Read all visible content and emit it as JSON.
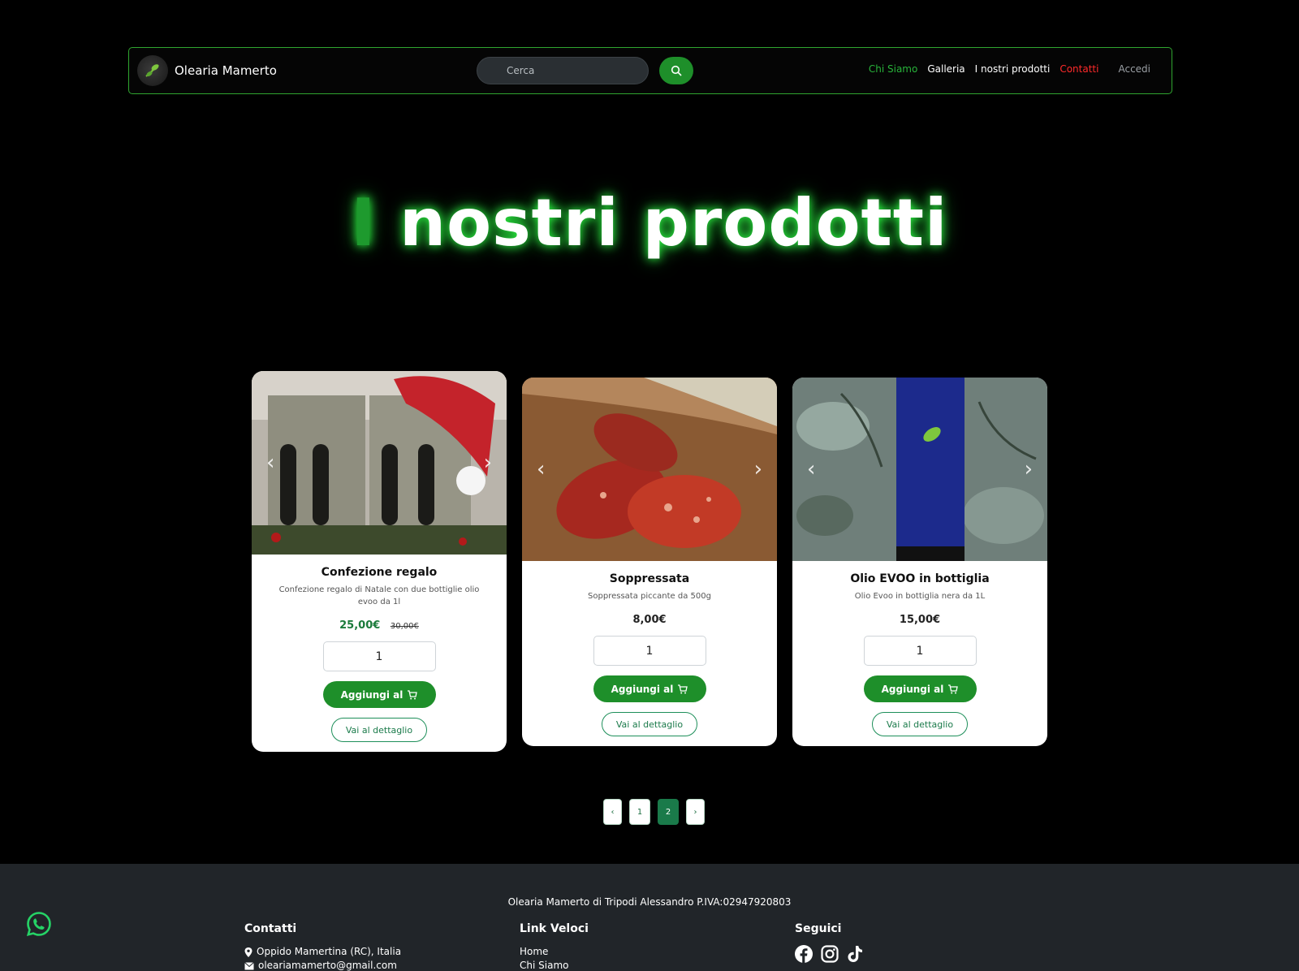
{
  "navbar": {
    "brand": "Olearia Mamerto",
    "search_placeholder": "Cerca",
    "links": {
      "chi_siamo": "Chi Siamo",
      "galleria": "Galleria",
      "prodotti": "I nostri prodotti",
      "contatti": "Contatti",
      "accedi": "Accedi"
    }
  },
  "hero": {
    "accent": "I",
    "rest": " nostri prodotti"
  },
  "products": [
    {
      "title": "Confezione regalo",
      "description": "Confezione regalo di Natale con due bottiglie olio evoo da 1l",
      "price": "25,00€",
      "old_price": "30,00€",
      "quantity": "1",
      "add_label": "Aggiungi al",
      "detail_label": "Vai al dettaglio"
    },
    {
      "title": "Soppressata",
      "description": "Soppressata piccante da 500g",
      "price": "8,00€",
      "quantity": "1",
      "add_label": "Aggiungi al",
      "detail_label": "Vai al dettaglio"
    },
    {
      "title": "Olio EVOO in bottiglia",
      "description": "Olio Evoo in bottiglia nera da 1L",
      "price": "15,00€",
      "quantity": "1",
      "add_label": "Aggiungi al",
      "detail_label": "Vai al dettaglio"
    }
  ],
  "pagination": {
    "prev": "‹",
    "pages": [
      "1",
      "2"
    ],
    "active": "2",
    "next": "›"
  },
  "footer": {
    "company": "Olearia Mamerto di Tripodi Alessandro P.IVA:02947920803",
    "contatti": {
      "title": "Contatti",
      "address": "Oppido Mamertina (RC), Italia",
      "email": "oleariamamerto@gmail.com"
    },
    "link_veloci": {
      "title": "Link Veloci",
      "links": [
        "Home",
        "Chi Siamo"
      ]
    },
    "seguici": {
      "title": "Seguici",
      "socials": [
        "facebook-icon",
        "instagram-icon",
        "tiktok-icon"
      ]
    }
  },
  "colors": {
    "brand_green": "#1e8f2a",
    "accent_red": "#ff2a2a",
    "footer_bg": "#212529"
  }
}
